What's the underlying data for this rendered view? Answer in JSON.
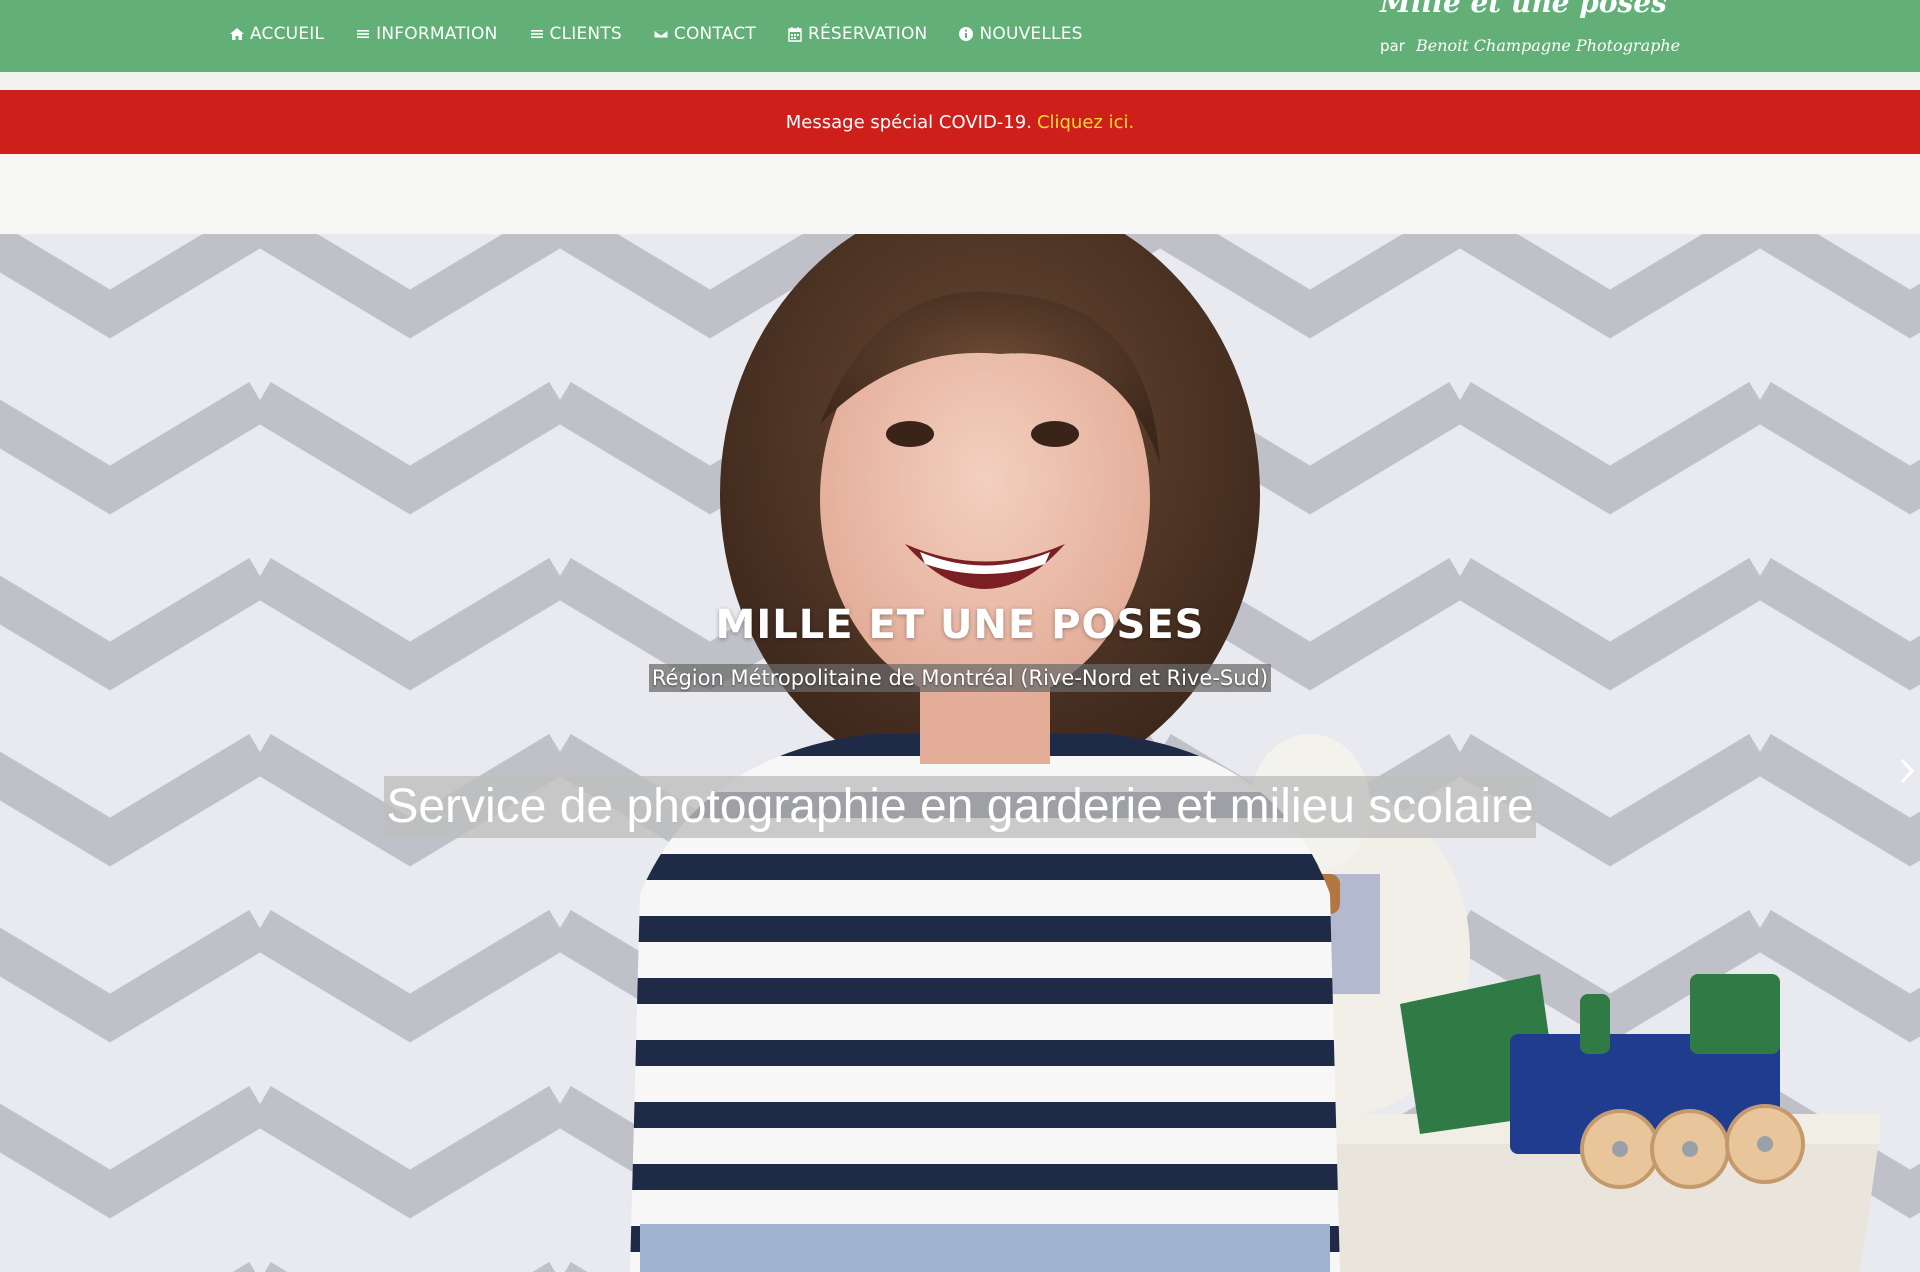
{
  "nav": {
    "items": [
      {
        "label": "ACCUEIL",
        "icon": "home-icon"
      },
      {
        "label": "INFORMATION",
        "icon": "menu-lines-icon"
      },
      {
        "label": "CLIENTS",
        "icon": "menu-lines-icon"
      },
      {
        "label": "CONTACT",
        "icon": "envelope-icon"
      },
      {
        "label": "RÉSERVATION",
        "icon": "calendar-icon"
      },
      {
        "label": "NOUVELLES",
        "icon": "info-icon"
      }
    ]
  },
  "brand": {
    "title": "Mille et une poses",
    "par": "par",
    "subtitle": "Benoit Champagne Photographe"
  },
  "covid": {
    "message": "Message spécial COVID-19.",
    "link": "Cliquez ici."
  },
  "hero": {
    "title": "MILLE ET UNE POSES",
    "subtitle": "Région Métropolitaine de Montréal (Rive-Nord et Rive-Sud)",
    "tagline": "Service de photographie en garderie et milieu scolaire",
    "next_icon": "chevron-right-icon"
  },
  "colors": {
    "header": "#62b077",
    "banner": "#cf1f1b",
    "link": "#ffd83b"
  }
}
